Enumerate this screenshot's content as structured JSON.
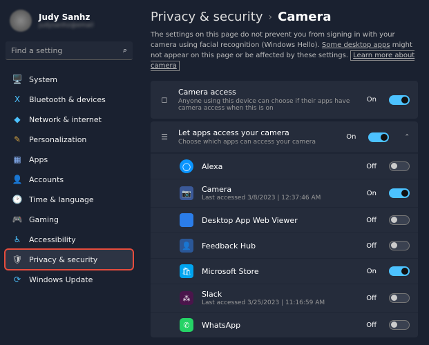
{
  "user": {
    "name": "Judy Sanhz",
    "email": "judysanhz@email"
  },
  "search": {
    "placeholder": "Find a setting"
  },
  "nav": [
    {
      "label": "System",
      "icon": "🖥️",
      "c": "#4cc2ff"
    },
    {
      "label": "Bluetooth & devices",
      "icon": "ⵝ",
      "c": "#4cc2ff"
    },
    {
      "label": "Network & internet",
      "icon": "◆",
      "c": "#4cc2ff"
    },
    {
      "label": "Personalization",
      "icon": "✎",
      "c": "#d0a040"
    },
    {
      "label": "Apps",
      "icon": "▦",
      "c": "#8ab4f8"
    },
    {
      "label": "Accounts",
      "icon": "👤",
      "c": "#ccc"
    },
    {
      "label": "Time & language",
      "icon": "🕑",
      "c": "#ccc"
    },
    {
      "label": "Gaming",
      "icon": "🎮",
      "c": "#ccc"
    },
    {
      "label": "Accessibility",
      "icon": "♿",
      "c": "#4cc2ff"
    },
    {
      "label": "Privacy & security",
      "icon": "🛡",
      "c": "#ccc",
      "active": true,
      "hl": true
    },
    {
      "label": "Windows Update",
      "icon": "⟳",
      "c": "#4cc2ff"
    }
  ],
  "breadcrumb": {
    "parent": "Privacy & security",
    "current": "Camera"
  },
  "desc": {
    "t1": "The settings on this page do not prevent you from signing in with your camera using facial recognition (Windows Hello). ",
    "t2": "Some desktop apps",
    "t3": " might not appear on this page or be affected by these settings. ",
    "learn": "Learn more about camera"
  },
  "access": {
    "title": "Camera access",
    "sub": "Anyone using this device can choose if their apps have camera access when this is on",
    "state": "On",
    "on": true
  },
  "letapps": {
    "title": "Let apps access your camera",
    "sub": "Choose which apps can access your camera",
    "state": "On",
    "on": true
  },
  "apps": [
    {
      "name": "Alexa",
      "icon": "◯",
      "cls": "ico-alexa",
      "state": "Off",
      "on": false
    },
    {
      "name": "Camera",
      "icon": "📷",
      "cls": "ico-camera",
      "sub": "Last accessed 3/8/2023 | 12:37:46 AM",
      "state": "On",
      "on": true
    },
    {
      "name": "Desktop App Web Viewer",
      "icon": "",
      "cls": "ico-desktop",
      "state": "Off",
      "on": false
    },
    {
      "name": "Feedback Hub",
      "icon": "👤",
      "cls": "ico-feedback",
      "state": "Off",
      "on": false
    },
    {
      "name": "Microsoft Store",
      "icon": "🛍",
      "cls": "ico-store",
      "state": "On",
      "on": true
    },
    {
      "name": "Slack",
      "icon": "⁂",
      "cls": "ico-slack",
      "sub": "Last accessed 3/25/2023 | 11:16:59 AM",
      "state": "Off",
      "on": false
    },
    {
      "name": "WhatsApp",
      "icon": "✆",
      "cls": "ico-whatsapp",
      "state": "Off",
      "on": false
    }
  ]
}
